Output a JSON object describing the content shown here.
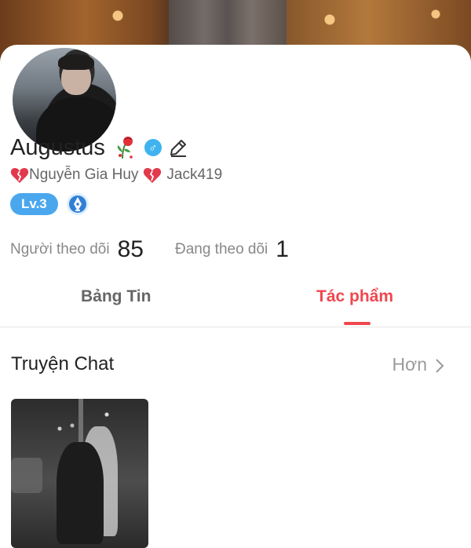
{
  "profile": {
    "name": "Augustus",
    "rose_icon": "wilted-rose-icon",
    "gender_symbol": "♂",
    "subtitle_left": "Nguyễn Gia Huy",
    "subtitle_right": "Jack419",
    "level": "Lv.3"
  },
  "stats": {
    "followers_label": "Người theo dõi",
    "followers_value": "85",
    "following_label": "Đang theo dõi",
    "following_value": "1"
  },
  "tabs": [
    {
      "label": "Bảng Tin",
      "active": false
    },
    {
      "label": "Tác phẩm",
      "active": true
    }
  ],
  "section": {
    "title": "Truyện Chat",
    "more_label": "Hơn"
  },
  "colors": {
    "accent": "#f0474f",
    "level_badge": "#4aa7ee",
    "gender_badge": "#3fb3ef",
    "heart": "#e23a4c"
  }
}
